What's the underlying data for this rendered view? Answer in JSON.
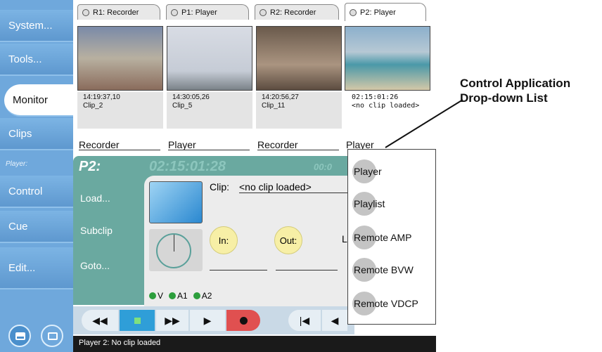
{
  "sidebar": {
    "items": [
      {
        "label": "System..."
      },
      {
        "label": "Tools..."
      },
      {
        "label": "Monitor"
      },
      {
        "label": "Clips"
      },
      {
        "label": "Control"
      },
      {
        "label": "Cue"
      },
      {
        "label": "Edit..."
      }
    ],
    "section_label": "Player:"
  },
  "tabs": [
    {
      "label": "R1: Recorder"
    },
    {
      "label": "P1: Player"
    },
    {
      "label": "R2: Recorder"
    },
    {
      "label": "P2: Player"
    }
  ],
  "channels": [
    {
      "timecode": "14:19:37,10",
      "clip": "Clip_2",
      "mode": "Recorder"
    },
    {
      "timecode": "14:30:05,26",
      "clip": "Clip_5",
      "mode": "Player"
    },
    {
      "timecode": "14:20:56,27",
      "clip": "Clip_11",
      "mode": "Recorder"
    },
    {
      "timecode": "02:15:01:26",
      "clip": "<no clip loaded>",
      "mode": "Player"
    }
  ],
  "control": {
    "channel_title": "P2:",
    "timecode_ghost": "02:15:01:28",
    "timecode_ghost2": "00:0",
    "clip_label": "Clip:",
    "clip_value": "<no clip loaded>",
    "buttons": {
      "load": "Load...",
      "subclip": "Subclip",
      "goto": "Goto..."
    },
    "in_label": "In:",
    "out_label": "Out:",
    "l_label": "L",
    "tracks": [
      "V",
      "A1",
      "A2"
    ]
  },
  "dropdown": {
    "items": [
      "Player",
      "Playlist",
      "Remote AMP",
      "Remote BVW",
      "Remote VDCP"
    ]
  },
  "status": "Player 2: No clip loaded",
  "callout": {
    "line1": "Control Application",
    "line2": "Drop-down List"
  },
  "colors": {
    "sidebar": "#6fa8dc",
    "panel": "#6aa9a0",
    "record": "#e05050",
    "stop": "#2f9ed8"
  }
}
